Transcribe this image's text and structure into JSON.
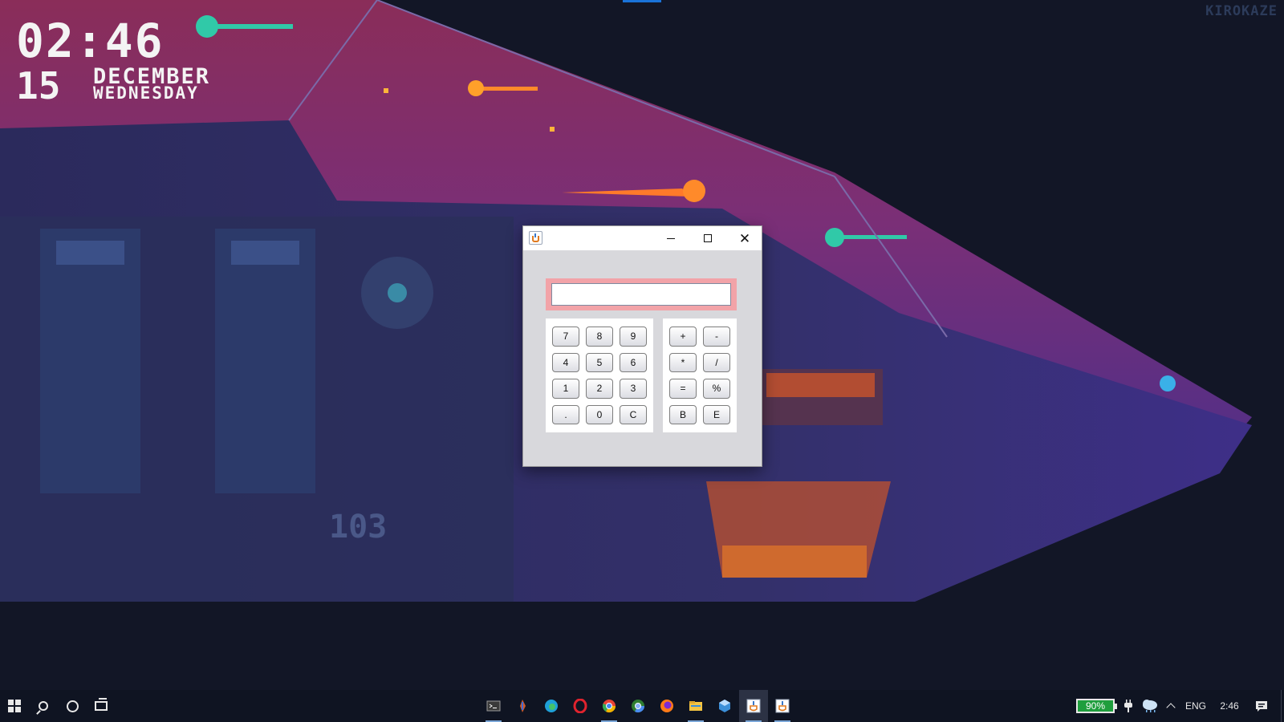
{
  "desktop": {
    "clock": {
      "time": "02:46",
      "day": "15",
      "month": "DECEMBER",
      "weekday": "WEDNESDAY"
    },
    "watermark": "KIROKAZE"
  },
  "window": {
    "title": "",
    "controls": {
      "minimize": "minimize-icon",
      "maximize": "maximize-icon",
      "close": "close-icon"
    },
    "display": {
      "value": ""
    },
    "digit_keys": [
      "7",
      "8",
      "9",
      "4",
      "5",
      "6",
      "1",
      "2",
      "3",
      ".",
      "0",
      "C"
    ],
    "operator_keys": [
      "+",
      "-",
      "*",
      "/",
      "=",
      "%",
      "B",
      "E"
    ],
    "colors": {
      "display_frame": "#f2a3a8",
      "window_bg": "#d8d8dc"
    }
  },
  "taskbar": {
    "left_icons": [
      "windows-start-icon",
      "search-icon",
      "cortana-icon",
      "task-view-icon"
    ],
    "apps": [
      {
        "icon": "terminal-icon",
        "color": "#3a3a3a"
      },
      {
        "icon": "pinned-app-icon",
        "color": "#cf5a2a"
      },
      {
        "icon": "edge-icon",
        "color": "#1fa0d8"
      },
      {
        "icon": "opera-icon",
        "color": "#e0232e"
      },
      {
        "icon": "chrome-icon",
        "color": "#f0b400"
      },
      {
        "icon": "chrome-alt-icon",
        "color": "#4a8cf0"
      },
      {
        "icon": "firefox-icon",
        "color": "#ff7a18"
      },
      {
        "icon": "file-explorer-icon",
        "color": "#f5c542"
      },
      {
        "icon": "virtualbox-icon",
        "color": "#3b8fd9"
      },
      {
        "icon": "java-app-icon",
        "color": "#e07a1f"
      },
      {
        "icon": "java-app-icon",
        "color": "#e07a1f"
      }
    ],
    "tray": {
      "battery": "90%",
      "language": "ENG",
      "time": "2:46",
      "icons": [
        "power-plug-icon",
        "weather-icon",
        "chevron-up-icon",
        "notification-icon"
      ]
    }
  }
}
